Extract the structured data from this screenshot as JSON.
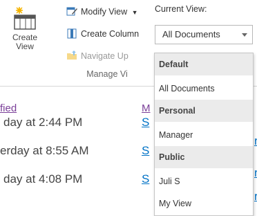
{
  "ribbon": {
    "create_view": "Create\nView",
    "modify_view": "Modify View",
    "create_column": "Create Column",
    "navigate_up": "Navigate Up",
    "group_label": "Manage Vi",
    "current_view_label": "Current View:",
    "current_view_value": "All Documents"
  },
  "dropdown": {
    "default_header": "Default",
    "default_item": "All Documents",
    "personal_header": "Personal",
    "personal_item": "Manager",
    "public_header": "Public",
    "public_item_1": "Juli S",
    "public_item_2": "My View"
  },
  "list": {
    "col_modified": "fied",
    "col_modified_by": "M",
    "rows": [
      {
        "modified": "day at 2:44 PM",
        "by": "S"
      },
      {
        "modified": "erday at 8:55 AM",
        "by": "S"
      },
      {
        "modified": "day at 4:08 PM",
        "by": "S"
      }
    ],
    "trailing_glyph": "r"
  },
  "colors": {
    "link": "#0072c6",
    "header_bg": "#ebebeb",
    "visited": "#7a3e98"
  }
}
